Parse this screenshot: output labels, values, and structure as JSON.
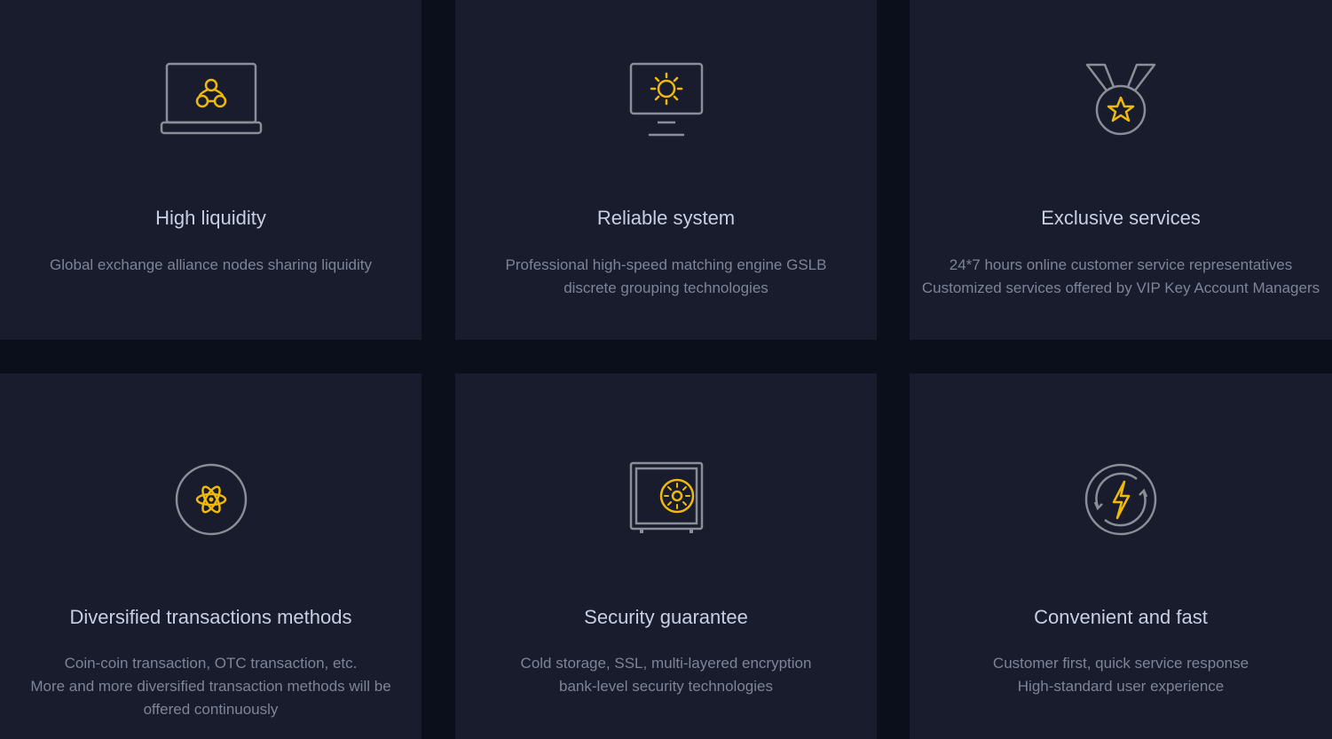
{
  "colors": {
    "page_background": "#0b0f1b",
    "card_background": "#181c2c",
    "icon_outline": "#8a8e99",
    "icon_accent": "#f0b90b",
    "title_text": "#c9cfe3",
    "description_text": "#7e8497"
  },
  "features": [
    {
      "icon": "laptop-network-icon",
      "title": "High liquidity",
      "lines": [
        "Global exchange alliance nodes sharing liquidity"
      ]
    },
    {
      "icon": "monitor-sun-icon",
      "title": "Reliable system",
      "lines": [
        "Professional high-speed matching engine GSLB",
        "discrete grouping technologies"
      ]
    },
    {
      "icon": "medal-star-icon",
      "title": "Exclusive services",
      "lines": [
        "24*7 hours online customer service representatives",
        "Customized services offered by VIP Key Account Managers"
      ]
    },
    {
      "icon": "atom-icon",
      "title": "Diversified transactions methods",
      "lines": [
        "Coin-coin transaction, OTC transaction, etc.",
        "More and more diversified transaction methods will be",
        "offered continuously"
      ]
    },
    {
      "icon": "safe-icon",
      "title": "Security guarantee",
      "lines": [
        "Cold storage, SSL, multi-layered encryption",
        "bank-level security technologies"
      ]
    },
    {
      "icon": "lightning-refresh-icon",
      "title": "Convenient and fast",
      "lines": [
        "Customer first, quick service response",
        "High-standard user experience"
      ]
    }
  ]
}
